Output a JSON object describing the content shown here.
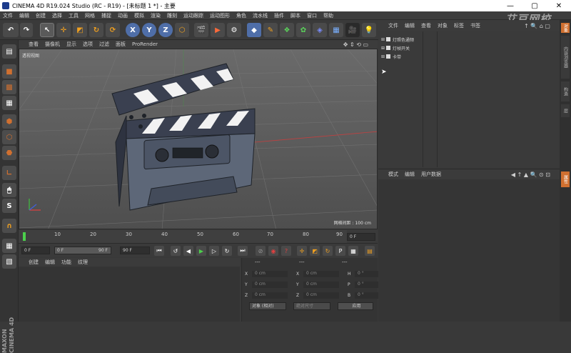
{
  "titlebar": {
    "title": "CINEMA 4D R19.024 Studio (RC - R19) - [未标题 1 *] - 主要",
    "min": "—",
    "max": "▢",
    "close": "✕"
  },
  "menu": [
    "文件",
    "编辑",
    "创建",
    "选择",
    "工具",
    "网格",
    "捕捉",
    "动画",
    "模拟",
    "渲染",
    "雕刻",
    "运动跟踪",
    "运动图形",
    "角色",
    "流水线",
    "插件",
    "脚本",
    "窗口",
    "帮助"
  ],
  "watermark": "艾豆网校",
  "viewport": {
    "menu": [
      "查看",
      "摄像机",
      "显示",
      "选项",
      "过滤",
      "面板",
      "ProRender"
    ],
    "label": "透视视图",
    "scale": "网格间距 : 100 cm"
  },
  "timeline": {
    "ticks": [
      "0",
      "10",
      "20",
      "30",
      "40",
      "50",
      "60",
      "70",
      "80",
      "90"
    ],
    "current_frame": "0 F"
  },
  "transport": {
    "start": "0 F",
    "range_start": "0 F",
    "range_end": "90 F",
    "end": "90 F"
  },
  "materials": {
    "menu": [
      "创建",
      "编辑",
      "功能",
      "纹理"
    ]
  },
  "coords": {
    "header": [
      "---",
      "---",
      "---"
    ],
    "rows": [
      {
        "a": "X",
        "av": "0 cm",
        "b": "X",
        "bv": "0 cm",
        "c": "H",
        "cv": "0 °"
      },
      {
        "a": "Y",
        "av": "0 cm",
        "b": "Y",
        "bv": "0 cm",
        "c": "P",
        "cv": "0 °"
      },
      {
        "a": "Z",
        "av": "0 cm",
        "b": "Z",
        "bv": "0 cm",
        "c": "B",
        "cv": "0 °"
      }
    ],
    "mode": "对象 (相对)",
    "size_mode": "绝对尺寸",
    "apply": "应用"
  },
  "objects": {
    "menu": [
      "文件",
      "编辑",
      "查看",
      "对象",
      "标签",
      "书签"
    ],
    "items": [
      "灯照色通频",
      "灯帧开关",
      "卡带"
    ]
  },
  "attributes": {
    "menu": [
      "模式",
      "编辑",
      "用户数据"
    ]
  },
  "right_tabs": [
    "对象",
    "内容浏览器",
    "构造",
    "层",
    "属性"
  ]
}
